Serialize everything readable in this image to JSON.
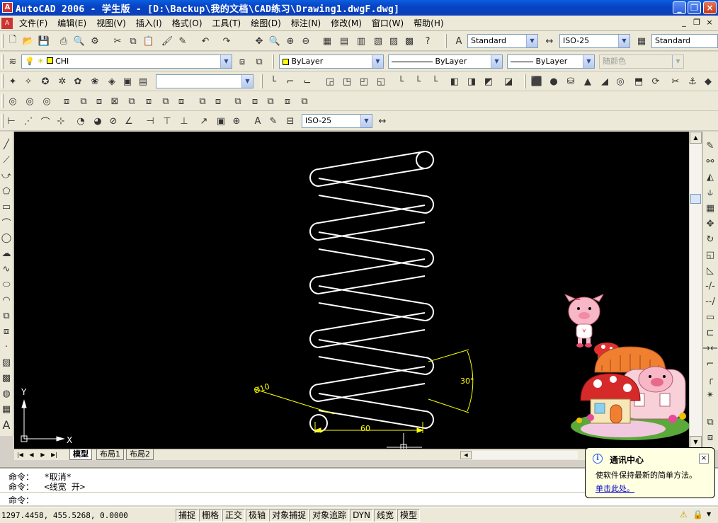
{
  "window": {
    "title": "AutoCAD 2006 - 学生版 - [D:\\Backup\\我的文档\\CAD练习\\Drawing1.dwgF.dwg]"
  },
  "menu": [
    "文件(F)",
    "编辑(E)",
    "视图(V)",
    "插入(I)",
    "格式(O)",
    "工具(T)",
    "绘图(D)",
    "标注(N)",
    "修改(M)",
    "窗口(W)",
    "帮助(H)"
  ],
  "toolbar1": {
    "text_style": "Standard",
    "dim_style": "ISO-25",
    "table_style": "Standard"
  },
  "layers": {
    "current_layer": "CHI",
    "color": "ByLayer",
    "linetype": "ByLayer",
    "lineweight": "ByLayer",
    "plot_style": "随颜色"
  },
  "dim_toolbar": {
    "dim_style": "ISO-25"
  },
  "drawing": {
    "dim_diameter": "Ø10",
    "dim_angle": "30°",
    "dim_width": "60",
    "ucs_x": "X",
    "ucs_y": "Y"
  },
  "tabs": [
    "模型",
    "布局1",
    "布局2"
  ],
  "command": {
    "line1": "命令：  *取消*",
    "line2": "命令：  <线宽 开>",
    "line3": "命令："
  },
  "status": {
    "coords": "1297.4458,  455.5268,  0.0000",
    "buttons": [
      "捕捉",
      "栅格",
      "正交",
      "极轴",
      "对象捕捉",
      "对象追踪",
      "DYN",
      "线宽",
      "模型"
    ]
  },
  "balloon": {
    "title": "通讯中心",
    "body": "使软件保持最新的简单方法。",
    "link": "单击此处。"
  },
  "colors": {
    "drawing_bg": "#000000",
    "spring_line": "#ffffff",
    "dimension": "#ffff00",
    "title_blue": "#0a5fe0"
  }
}
